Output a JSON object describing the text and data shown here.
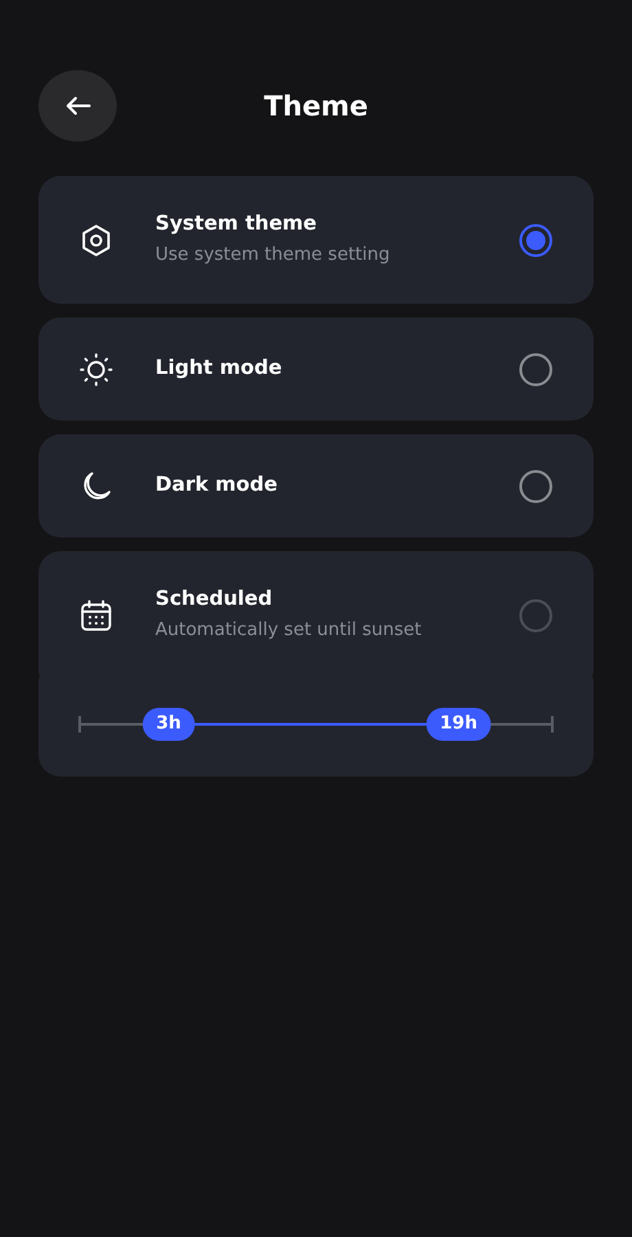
{
  "header": {
    "title": "Theme"
  },
  "options": [
    {
      "kind": "system",
      "title": "System theme",
      "subtitle": "Use system theme setting",
      "selected": true,
      "disabled": false
    },
    {
      "kind": "light",
      "title": "Light mode",
      "selected": false,
      "disabled": false
    },
    {
      "kind": "dark",
      "title": "Dark mode",
      "selected": false,
      "disabled": false
    },
    {
      "kind": "scheduled",
      "title": "Scheduled",
      "subtitle": "Automatically set until sunset",
      "selected": false,
      "disabled": true
    }
  ],
  "schedule_range": {
    "thumbs": [
      {
        "label": "3h",
        "level": 0.19
      },
      {
        "label": "19h",
        "level": 0.8
      }
    ]
  }
}
